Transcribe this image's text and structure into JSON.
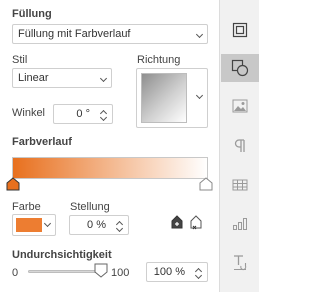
{
  "fill": {
    "label": "Füllung",
    "type_value": "Füllung mit Farbverlauf"
  },
  "style": {
    "label": "Stil",
    "value": "Linear"
  },
  "direction": {
    "label": "Richtung"
  },
  "angle": {
    "label": "Winkel",
    "value": "0 °"
  },
  "gradient": {
    "label": "Farbverlauf",
    "start_color": "#e8701e",
    "end_color": "#ffffff",
    "stops": [
      0,
      1
    ],
    "selected_stop": 0
  },
  "color": {
    "label": "Farbe",
    "value": "#ed7d31"
  },
  "position": {
    "label": "Stellung",
    "value": "0 %"
  },
  "opacity": {
    "label": "Undurchsichtigkeit",
    "min": "0",
    "max": "100",
    "value": "100 %",
    "level": 1.0
  },
  "sidebar": {
    "items": [
      {
        "icon": "shape-settings-icon",
        "active": false
      },
      {
        "icon": "shape-fill-icon",
        "active": true
      },
      {
        "icon": "image-icon",
        "active": false
      },
      {
        "icon": "paragraph-icon",
        "active": false
      },
      {
        "icon": "table-icon",
        "active": false
      },
      {
        "icon": "chart-icon",
        "active": false
      },
      {
        "icon": "text-art-icon",
        "active": false
      }
    ]
  }
}
